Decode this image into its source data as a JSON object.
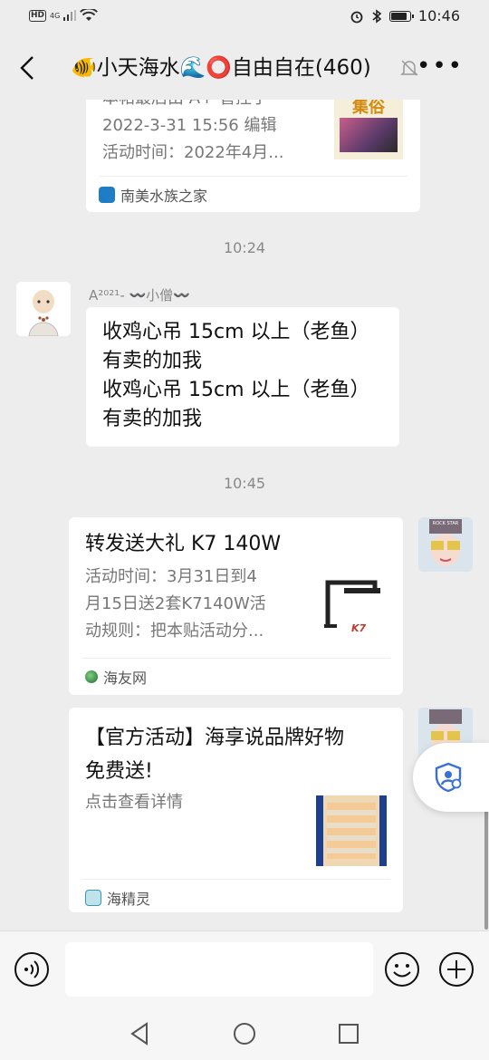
{
  "status_bar": {
    "hd": "HD",
    "network": "4G",
    "time": "10:46"
  },
  "header": {
    "title": "🐠小天海水🌊⭕自由自在(460)"
  },
  "messages": {
    "card1": {
      "title_partial": "本帖最后由 A+ 管控于",
      "edit_line": "2022-3-31 15:56 编辑",
      "activity_line": "活动时间：2022年4月...",
      "thumb_text": "集俗",
      "source": "南美水族之家"
    },
    "time1": "10:24",
    "msg2": {
      "sender": "A²⁰²¹- 〰️小僧〰️",
      "lines": [
        "收鸡心吊 15cm 以上（老鱼）",
        "有卖的加我",
        "收鸡心吊 15cm 以上（老鱼）",
        "有卖的加我"
      ]
    },
    "time2": "10:45",
    "card3": {
      "title": "转发送大礼 K7 140W",
      "desc_lines": [
        "活动时间：3月31日到4",
        "月15日送2套K7140W活",
        "动规则：把本贴活动分..."
      ],
      "thumb_text": "K7",
      "source": "海友网"
    },
    "card4": {
      "title_lines": [
        "【官方活动】海享说品牌好物",
        "免费送!"
      ],
      "desc": "点击查看详情",
      "source": "海精灵"
    }
  },
  "avatar_text": "ROCK STAR",
  "icons": {
    "back": "back-arrow-icon",
    "mute": "mute-bell-icon",
    "more": "more-icon",
    "voice": "voice-icon",
    "emoji": "emoji-icon",
    "plus": "plus-icon",
    "shield": "shield-user-icon"
  },
  "colors": {
    "background": "#ededed",
    "bubble": "#ffffff",
    "accent": "#3a6fd8"
  }
}
